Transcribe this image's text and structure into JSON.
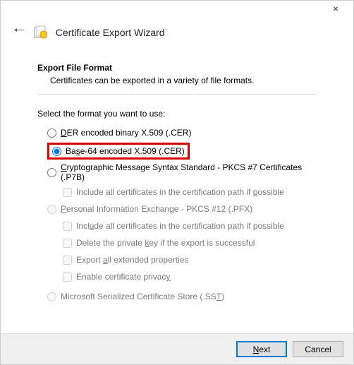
{
  "window": {
    "title": "Certificate Export Wizard",
    "close_label": "×"
  },
  "page": {
    "section_title": "Export File Format",
    "section_desc": "Certificates can be exported in a variety of file formats.",
    "prompt": "Select the format you want to use:"
  },
  "options": {
    "der": {
      "label_pre": "DER encoded binary X.509 (.CER)",
      "under": "D",
      "rest": "ER encoded binary X.509 (.CER)"
    },
    "base64": {
      "under": "s",
      "pre": "Ba",
      "post": "e-64 encoded X.509 (.CER)"
    },
    "pkcs7": {
      "under": "C",
      "post": "ryptographic Message Syntax Standard - PKCS #7 Certificates (.P7B)"
    },
    "pkcs7_incl": {
      "pre": "Include all certificates in the certification path if ",
      "under": "p",
      "post": "ossible"
    },
    "pfx": {
      "under": "P",
      "post": "ersonal Information Exchange - PKCS #12 (.PFX)"
    },
    "pfx_incl": {
      "pre": "Incl",
      "under": "u",
      "post": "de all certificates in the certification path if possible"
    },
    "pfx_del": {
      "pre": "Delete the private ",
      "under": "k",
      "post": "ey if the export is successful"
    },
    "pfx_ext": {
      "pre": "Export ",
      "under": "a",
      "post": "ll extended properties"
    },
    "pfx_priv": {
      "pre": "Enable certificate privac",
      "under": "y",
      "post": ""
    },
    "sst": {
      "pre": "Microsoft Serialized Certificate Store (.SS",
      "under": "T",
      "post": ")"
    }
  },
  "footer": {
    "next_under": "N",
    "next_rest": "ext",
    "cancel": "Cancel"
  }
}
